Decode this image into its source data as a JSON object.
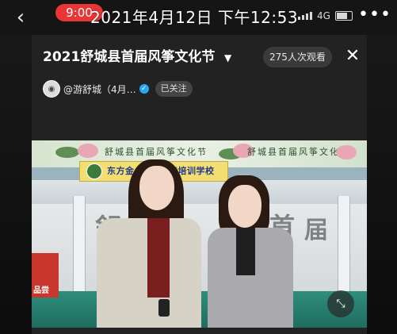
{
  "status_bar": {
    "time_pill": "9:00",
    "datetime": "2021年4月12日 下午12:53",
    "network": "4G"
  },
  "header": {
    "title": "2021舒城县首届风筝文化节",
    "viewers": "275人次观看"
  },
  "author": {
    "name": "@游舒城（4月…",
    "follow_label": "已关注"
  },
  "video": {
    "banner_text": "舒城县首届风筝文化节",
    "school_sign": "东方金",
    "school_sign_tail": "能培训学校",
    "calligraphy": [
      "舒",
      "首",
      "届"
    ],
    "board_text": "品尝"
  },
  "icons": {
    "back": "chevron-left-icon",
    "close": "close-icon",
    "more": "more-dots-icon",
    "fullscreen": "fullscreen-icon"
  },
  "colors": {
    "time_pill": "#e83535",
    "verified": "#27a7f4"
  }
}
